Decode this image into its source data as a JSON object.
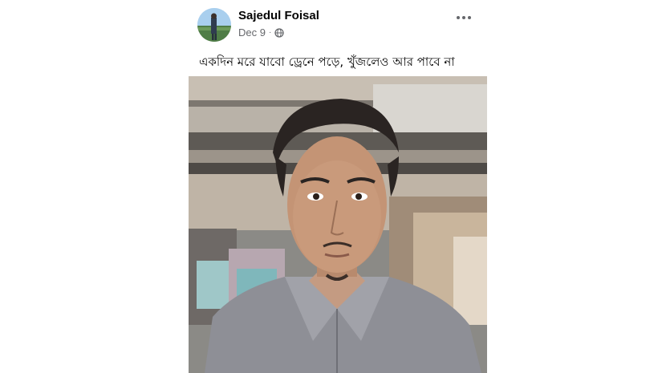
{
  "post": {
    "author": "Sajedul Foisal",
    "date": "Dec 9",
    "separator": "·",
    "privacy_icon": "globe-icon",
    "more_icon": "more-options-icon",
    "caption": "একদিন মরে যাবো ড্রেনে পড়ে, খুঁজলেও আর পাবে না"
  },
  "colors": {
    "name": "#050505",
    "meta": "#65676b",
    "background": "#ffffff"
  }
}
